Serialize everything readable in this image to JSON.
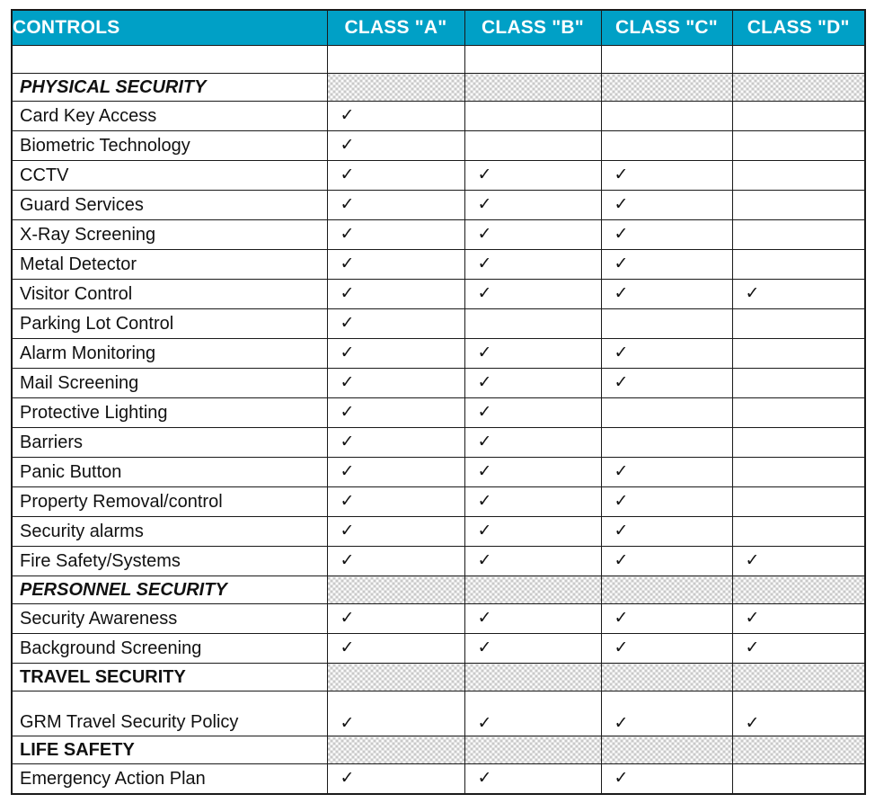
{
  "table": {
    "columns": [
      {
        "key": "controls",
        "label": "CONTROLS"
      },
      {
        "key": "a",
        "label": "CLASS \"A\""
      },
      {
        "key": "b",
        "label": "CLASS \"B\""
      },
      {
        "key": "c",
        "label": "CLASS \"C\""
      },
      {
        "key": "d",
        "label": "CLASS \"D\""
      }
    ],
    "header_background": "#00A0C6",
    "header_text_color": "#FFFFFF",
    "section_fill_color": "#C9C9C9",
    "check_glyph": "✓",
    "rows": [
      {
        "type": "spacer",
        "label": ""
      },
      {
        "type": "section",
        "label": "PHYSICAL SECURITY",
        "style": "bold-italic"
      },
      {
        "type": "item",
        "label": "Card Key Access",
        "marks": [
          true,
          false,
          false,
          false
        ]
      },
      {
        "type": "item",
        "label": "Biometric Technology",
        "marks": [
          true,
          false,
          false,
          false
        ]
      },
      {
        "type": "item",
        "label": "CCTV",
        "marks": [
          true,
          true,
          true,
          false
        ]
      },
      {
        "type": "item",
        "label": "Guard Services",
        "marks": [
          true,
          true,
          true,
          false
        ]
      },
      {
        "type": "item",
        "label": "X-Ray Screening",
        "marks": [
          true,
          true,
          true,
          false
        ]
      },
      {
        "type": "item",
        "label": "Metal Detector",
        "marks": [
          true,
          true,
          true,
          false
        ]
      },
      {
        "type": "item",
        "label": "Visitor Control",
        "marks": [
          true,
          true,
          true,
          true
        ]
      },
      {
        "type": "item",
        "label": "Parking Lot Control",
        "marks": [
          true,
          false,
          false,
          false
        ]
      },
      {
        "type": "item",
        "label": "Alarm Monitoring",
        "marks": [
          true,
          true,
          true,
          false
        ]
      },
      {
        "type": "item",
        "label": "Mail Screening",
        "marks": [
          true,
          true,
          true,
          false
        ]
      },
      {
        "type": "item",
        "label": "Protective Lighting",
        "marks": [
          true,
          true,
          false,
          false
        ]
      },
      {
        "type": "item",
        "label": "Barriers",
        "marks": [
          true,
          true,
          false,
          false
        ]
      },
      {
        "type": "item",
        "label": "Panic Button",
        "marks": [
          true,
          true,
          true,
          false
        ]
      },
      {
        "type": "item",
        "label": "Property Removal/control",
        "marks": [
          true,
          true,
          true,
          false
        ]
      },
      {
        "type": "item",
        "label": "Security alarms",
        "marks": [
          true,
          true,
          true,
          false
        ]
      },
      {
        "type": "item",
        "label": "Fire Safety/Systems",
        "marks": [
          true,
          true,
          true,
          true
        ]
      },
      {
        "type": "section",
        "label": "PERSONNEL SECURITY",
        "style": "bold-italic"
      },
      {
        "type": "item",
        "label": "Security Awareness",
        "marks": [
          true,
          true,
          true,
          true
        ]
      },
      {
        "type": "item",
        "label": "Background Screening",
        "marks": [
          true,
          true,
          true,
          true
        ]
      },
      {
        "type": "section",
        "label": "TRAVEL SECURITY",
        "style": "bold"
      },
      {
        "type": "item",
        "label": "GRM Travel Security Policy",
        "marks": [
          true,
          true,
          true,
          true
        ],
        "tall": true
      },
      {
        "type": "section",
        "label": "LIFE SAFETY",
        "style": "bold"
      },
      {
        "type": "item",
        "label": "Emergency Action Plan",
        "marks": [
          true,
          true,
          true,
          false
        ]
      }
    ]
  }
}
